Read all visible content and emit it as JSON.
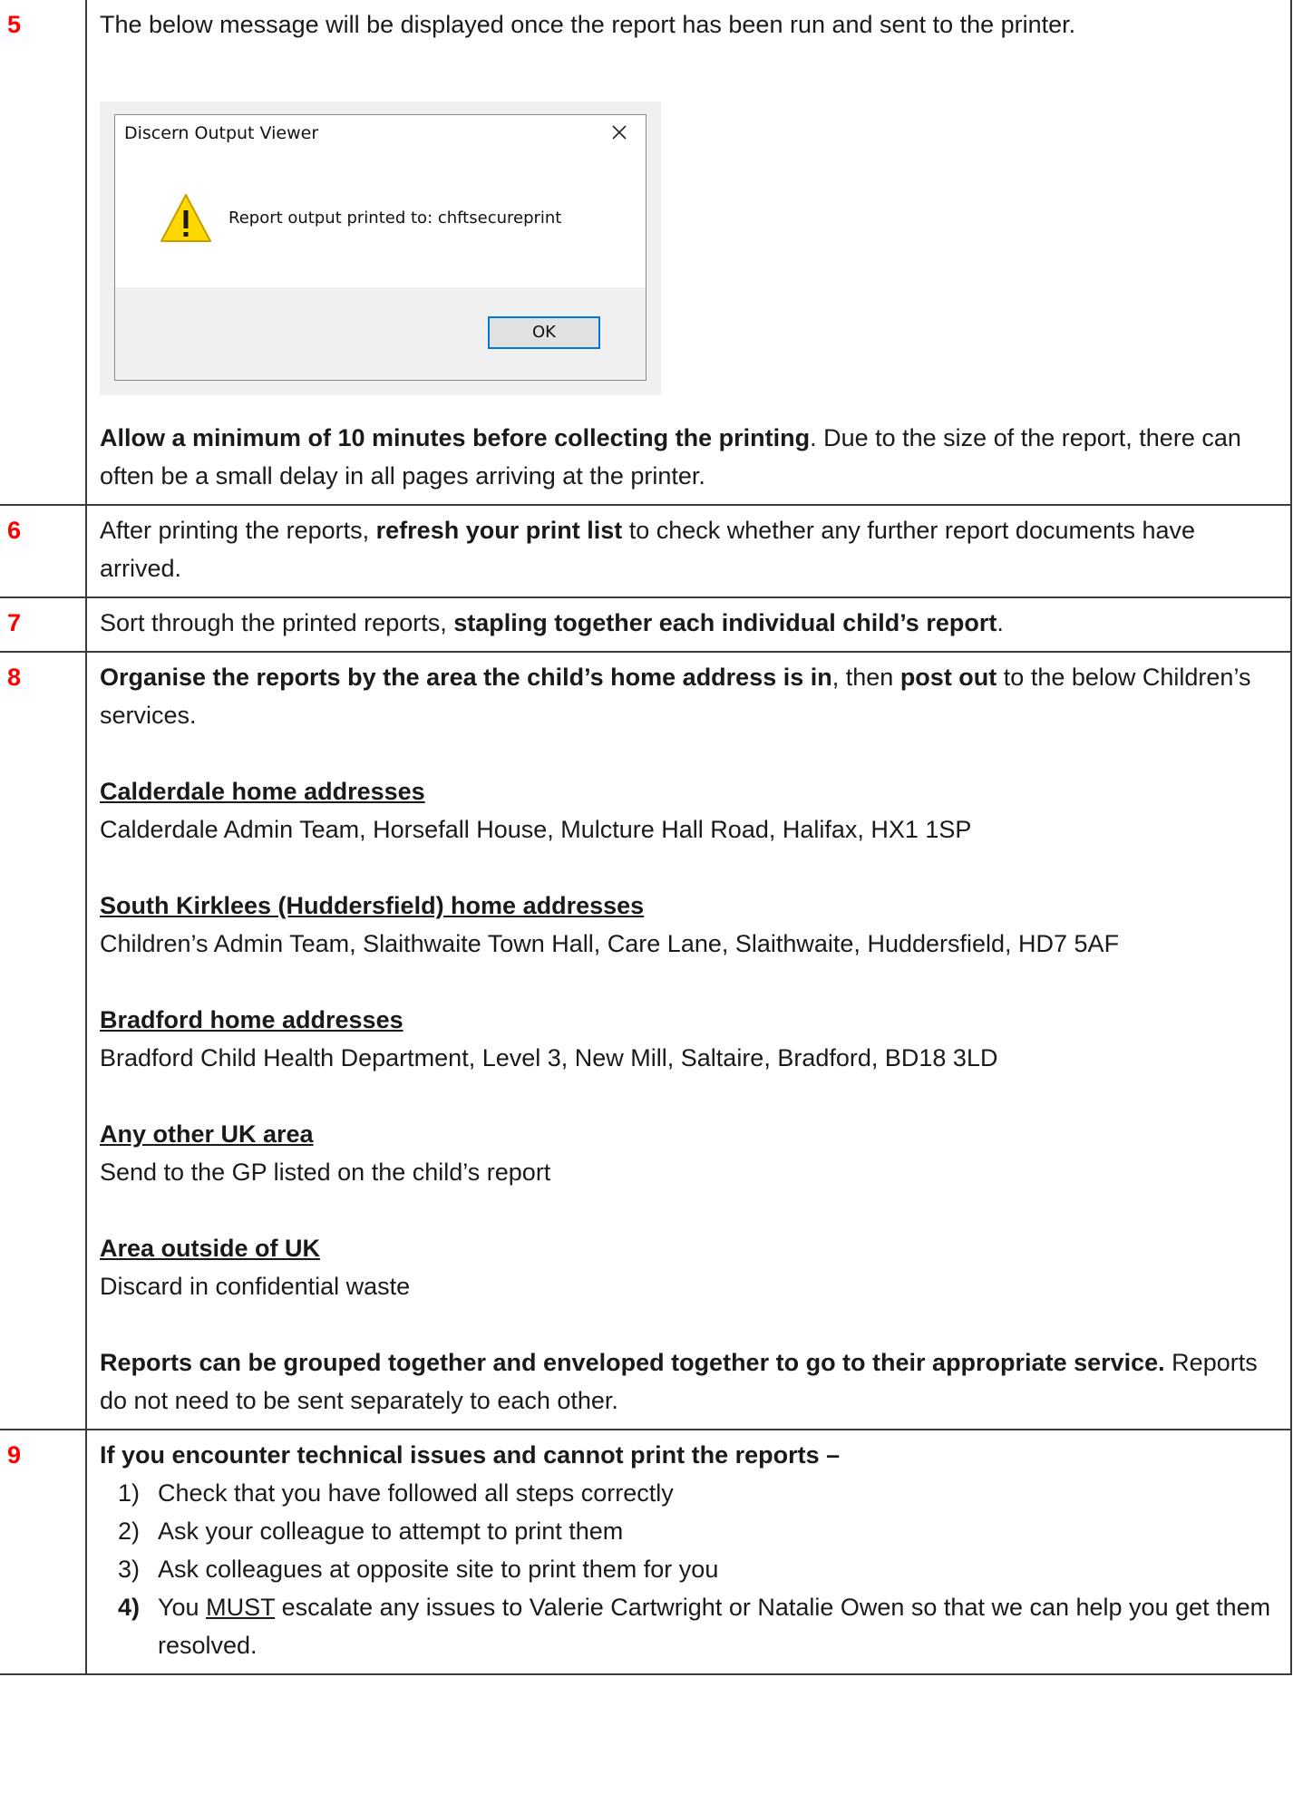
{
  "steps": [
    {
      "number": "5",
      "intro": "The below message will be displayed once the report has been run and sent to the printer.",
      "dialog": {
        "title": "Discern Output Viewer",
        "message": "Report output printed to:  chftsecureprint",
        "ok_label": "OK",
        "close_icon": "close-icon",
        "warning_icon": "warning-icon"
      },
      "note_bold": "Allow a minimum of 10 minutes before collecting the printing",
      "note_rest": ". Due to the size of the report, there can often be a small delay in all pages arriving at the printer."
    },
    {
      "number": "6",
      "text_a": "After printing the reports, ",
      "text_b": "refresh your print list",
      "text_c": " to check whether any further report documents have arrived."
    },
    {
      "number": "7",
      "text_a": "Sort through the printed reports, ",
      "text_b": "stapling together each individual child’s report",
      "text_c": "."
    },
    {
      "number": "8",
      "intro_bold1": "Organise the reports by the area the child’s home address is in",
      "intro_mid": ", then ",
      "intro_bold2": "post out",
      "intro_end": " to the below Children’s services.",
      "areas": [
        {
          "heading": "Calderdale home addresses",
          "address": "Calderdale Admin Team, Horsefall House, Mulcture Hall Road, Halifax, HX1 1SP"
        },
        {
          "heading": "South Kirklees (Huddersfield) home addresses",
          "address": "Children’s Admin Team, Slaithwaite Town Hall, Care Lane, Slaithwaite, Huddersfield, HD7 5AF"
        },
        {
          "heading": "Bradford home addresses",
          "address": "Bradford Child Health Department, Level 3, New Mill, Saltaire, Bradford, BD18 3LD"
        },
        {
          "heading": "Any other UK area",
          "address": "Send to the GP listed on the child’s report"
        },
        {
          "heading": "Area outside of UK",
          "address": "Discard in confidential waste"
        }
      ],
      "closing_bold": "Reports can be grouped together and enveloped together to go to their appropriate service.",
      "closing_rest": " Reports do not need to be sent separately to each other."
    },
    {
      "number": "9",
      "heading": "If you encounter technical issues and cannot print the reports –",
      "items": [
        {
          "num": "1)",
          "text": "Check that you have followed all steps correctly"
        },
        {
          "num": "2)",
          "text": "Ask your colleague to attempt to print them"
        },
        {
          "num": "3)",
          "text": "Ask colleagues at opposite site to print them for you"
        }
      ],
      "item4": {
        "num": "4)",
        "pre": "You ",
        "must": "MUST",
        "post": " escalate any issues to Valerie Cartwright or Natalie Owen so that we can help you get them resolved."
      }
    }
  ]
}
